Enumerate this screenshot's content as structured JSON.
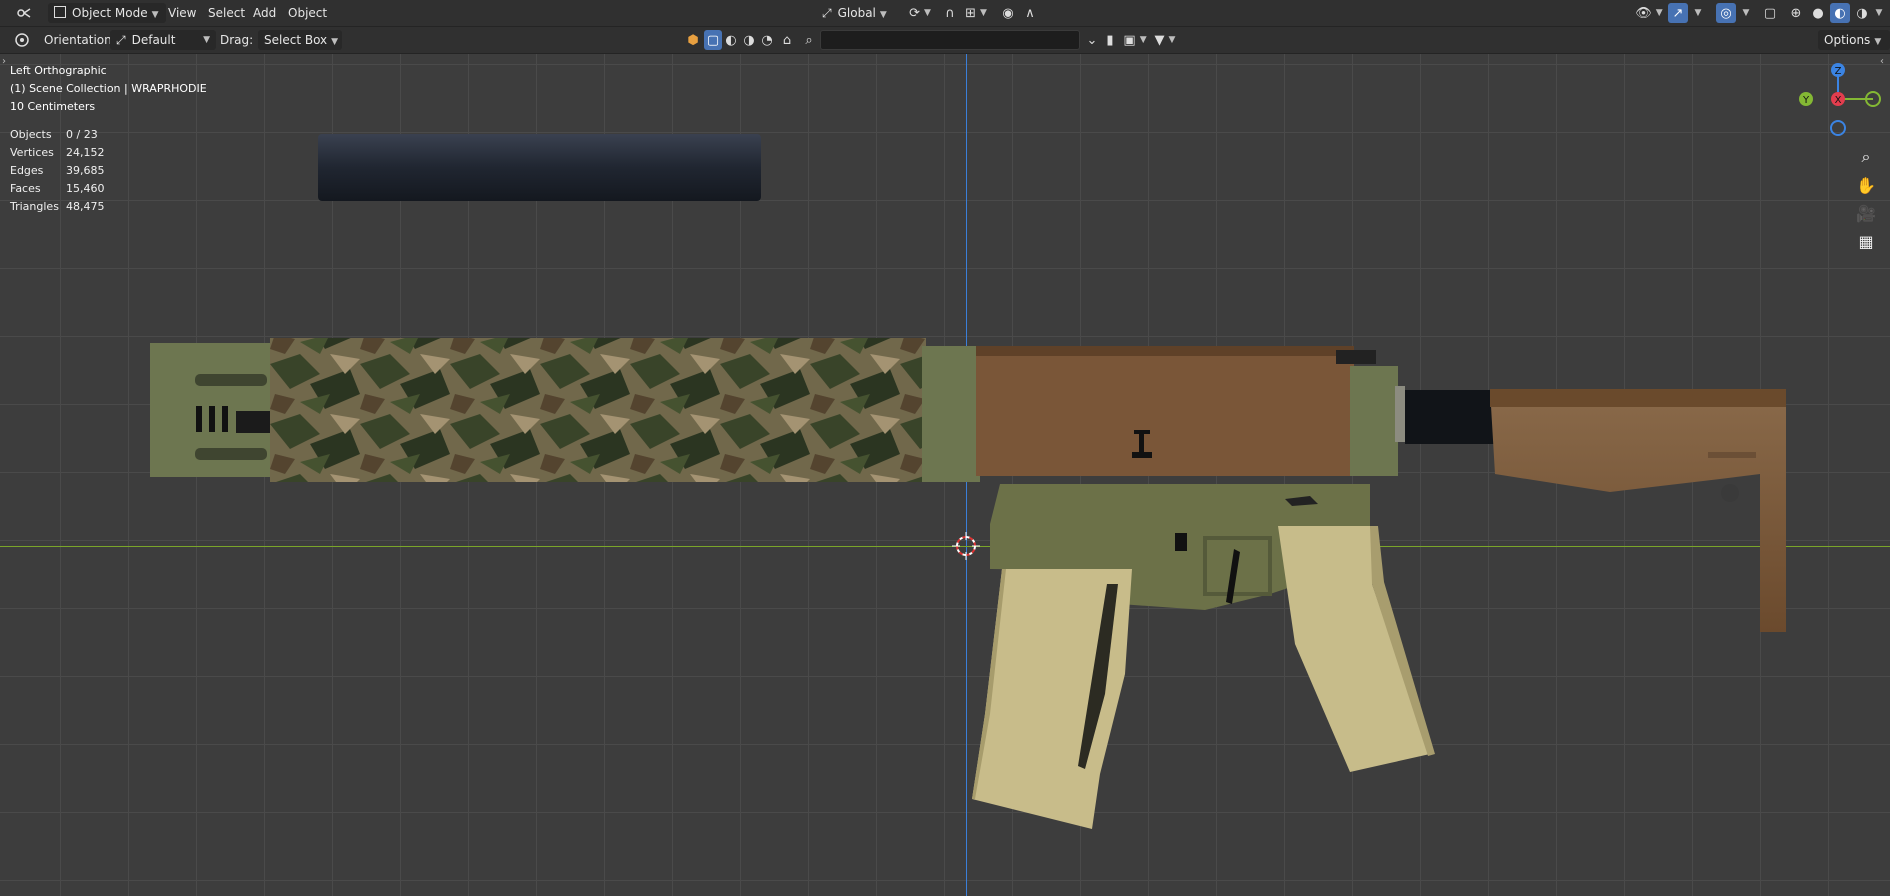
{
  "header": {
    "mode": "Object Mode",
    "menus": [
      "View",
      "Select",
      "Add",
      "Object"
    ],
    "transform_orientation": "Global"
  },
  "toolbar": {
    "orientation_label": "Orientation:",
    "orientation_value": "Default",
    "drag_label": "Drag:",
    "drag_value": "Select Box",
    "options_label": "Options",
    "search_placeholder": ""
  },
  "viewport": {
    "view_name": "Left Orthographic",
    "collection": "(1) Scene Collection | WRAPRHODIE",
    "scale": "10 Centimeters",
    "stats": [
      {
        "label": "Objects",
        "value": "0 / 23"
      },
      {
        "label": "Vertices",
        "value": "24,152"
      },
      {
        "label": "Edges",
        "value": "39,685"
      },
      {
        "label": "Faces",
        "value": "15,460"
      },
      {
        "label": "Triangles",
        "value": "48,475"
      }
    ],
    "gizmo": {
      "z": "Z",
      "y": "Y",
      "x": "X"
    }
  },
  "colors": {
    "x_axis": "#e33d4e",
    "y_axis": "#84b834",
    "z_axis": "#3b84e3",
    "active": "#4772b3"
  }
}
